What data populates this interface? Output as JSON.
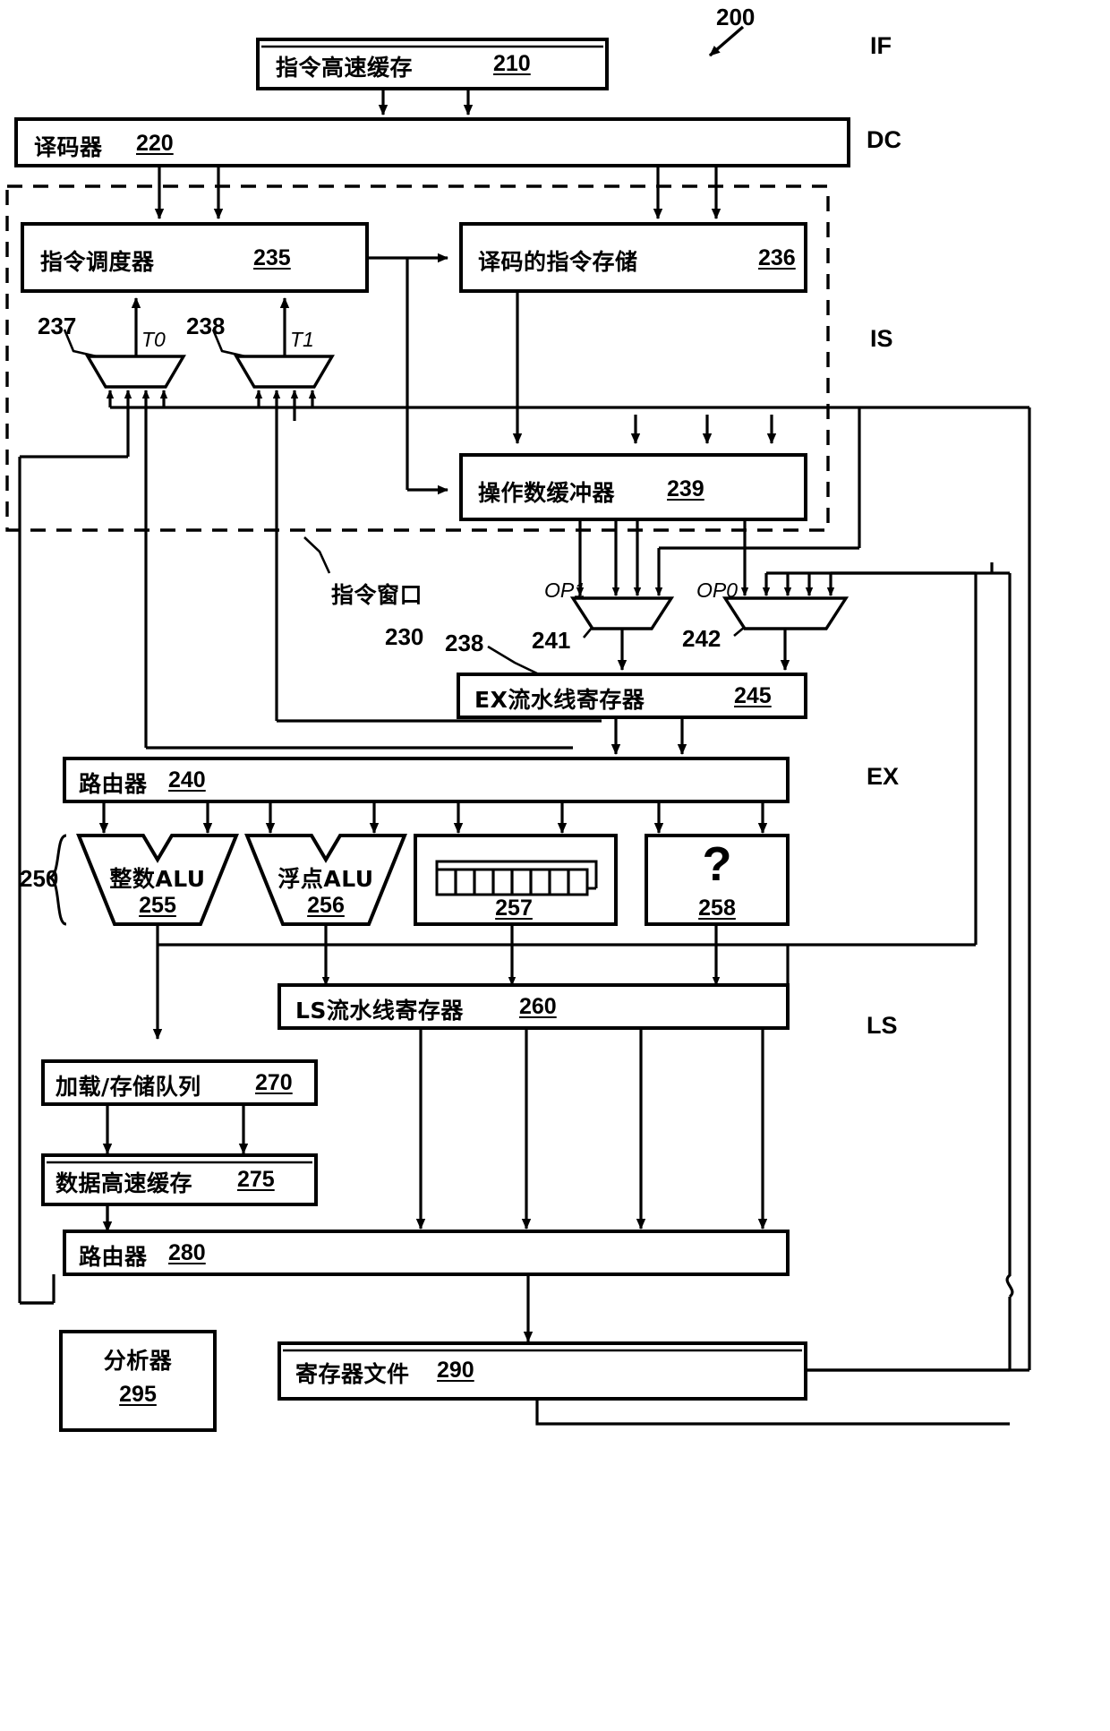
{
  "figure": {
    "id": "200",
    "title_ref": "200"
  },
  "stages": [
    {
      "key": "IF",
      "label": "IF"
    },
    {
      "key": "DC",
      "label": "DC"
    },
    {
      "key": "IS",
      "label": "IS"
    },
    {
      "key": "EX",
      "label": "EX"
    },
    {
      "key": "LS",
      "label": "LS"
    }
  ],
  "blocks": {
    "icache": {
      "label": "指令高速缓存",
      "num": "210"
    },
    "decoder": {
      "label": "译码器",
      "num": "220"
    },
    "scheduler": {
      "label": "指令调度器",
      "num": "235"
    },
    "decoded_store": {
      "label": "译码的指令存储",
      "num": "236"
    },
    "operand_buffer": {
      "label": "操作数缓冲器",
      "num": "239"
    },
    "ex_pipe_reg": {
      "label": "EX流水线寄存器",
      "num": "245"
    },
    "router_240": {
      "label": "路由器",
      "num": "240"
    },
    "int_alu": {
      "label": "整数ALU",
      "num": "255"
    },
    "fp_alu": {
      "label": "浮点ALU",
      "num": "256"
    },
    "shift_reg": {
      "label": "",
      "num": "257",
      "cells": 8
    },
    "unknown_unit": {
      "label": "?",
      "num": "258"
    },
    "ls_pipe_reg": {
      "label": "LS流水线寄存器",
      "num": "260"
    },
    "ls_queue": {
      "label": "加载/存储队列",
      "num": "270"
    },
    "dcache": {
      "label": "数据高速缓存",
      "num": "275"
    },
    "router_280": {
      "label": "路由器",
      "num": "280"
    },
    "analyzer": {
      "label": "分析器",
      "num": "295"
    },
    "regfile": {
      "label": "寄存器文件",
      "num": "290"
    }
  },
  "mux_labels": {
    "t0": "T0",
    "t1": "T1",
    "op1": "OP1",
    "op0": "OP0"
  },
  "ref_numbers": {
    "r237": "237",
    "r238_top": "238",
    "r241": "241",
    "r242": "242",
    "r250": "250",
    "r230": "230",
    "r238_win": "238"
  },
  "annotations": {
    "instruction_window": "指令窗口"
  },
  "colors": {
    "ink": "#000000",
    "paper": "#ffffff"
  }
}
